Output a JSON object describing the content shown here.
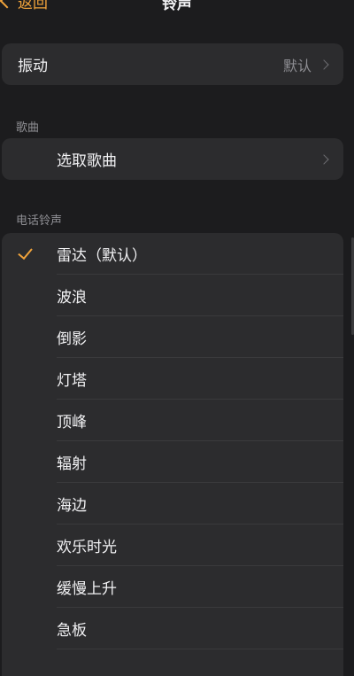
{
  "nav": {
    "back_label": "返回",
    "title": "铃声"
  },
  "vibration": {
    "label": "振动",
    "value": "默认"
  },
  "songs_section": {
    "header": "歌曲",
    "pick_label": "选取歌曲"
  },
  "ringtone_section": {
    "header": "电话铃声",
    "items": [
      {
        "label": "雷达（默认）",
        "selected": true
      },
      {
        "label": "波浪",
        "selected": false
      },
      {
        "label": "倒影",
        "selected": false
      },
      {
        "label": "灯塔",
        "selected": false
      },
      {
        "label": "顶峰",
        "selected": false
      },
      {
        "label": "辐射",
        "selected": false
      },
      {
        "label": "海边",
        "selected": false
      },
      {
        "label": "欢乐时光",
        "selected": false
      },
      {
        "label": "缓慢上升",
        "selected": false
      },
      {
        "label": "急板",
        "selected": false
      }
    ]
  },
  "colors": {
    "accent": "#f1a33b",
    "background": "#1c1c1e",
    "cell": "#2c2c2e"
  }
}
